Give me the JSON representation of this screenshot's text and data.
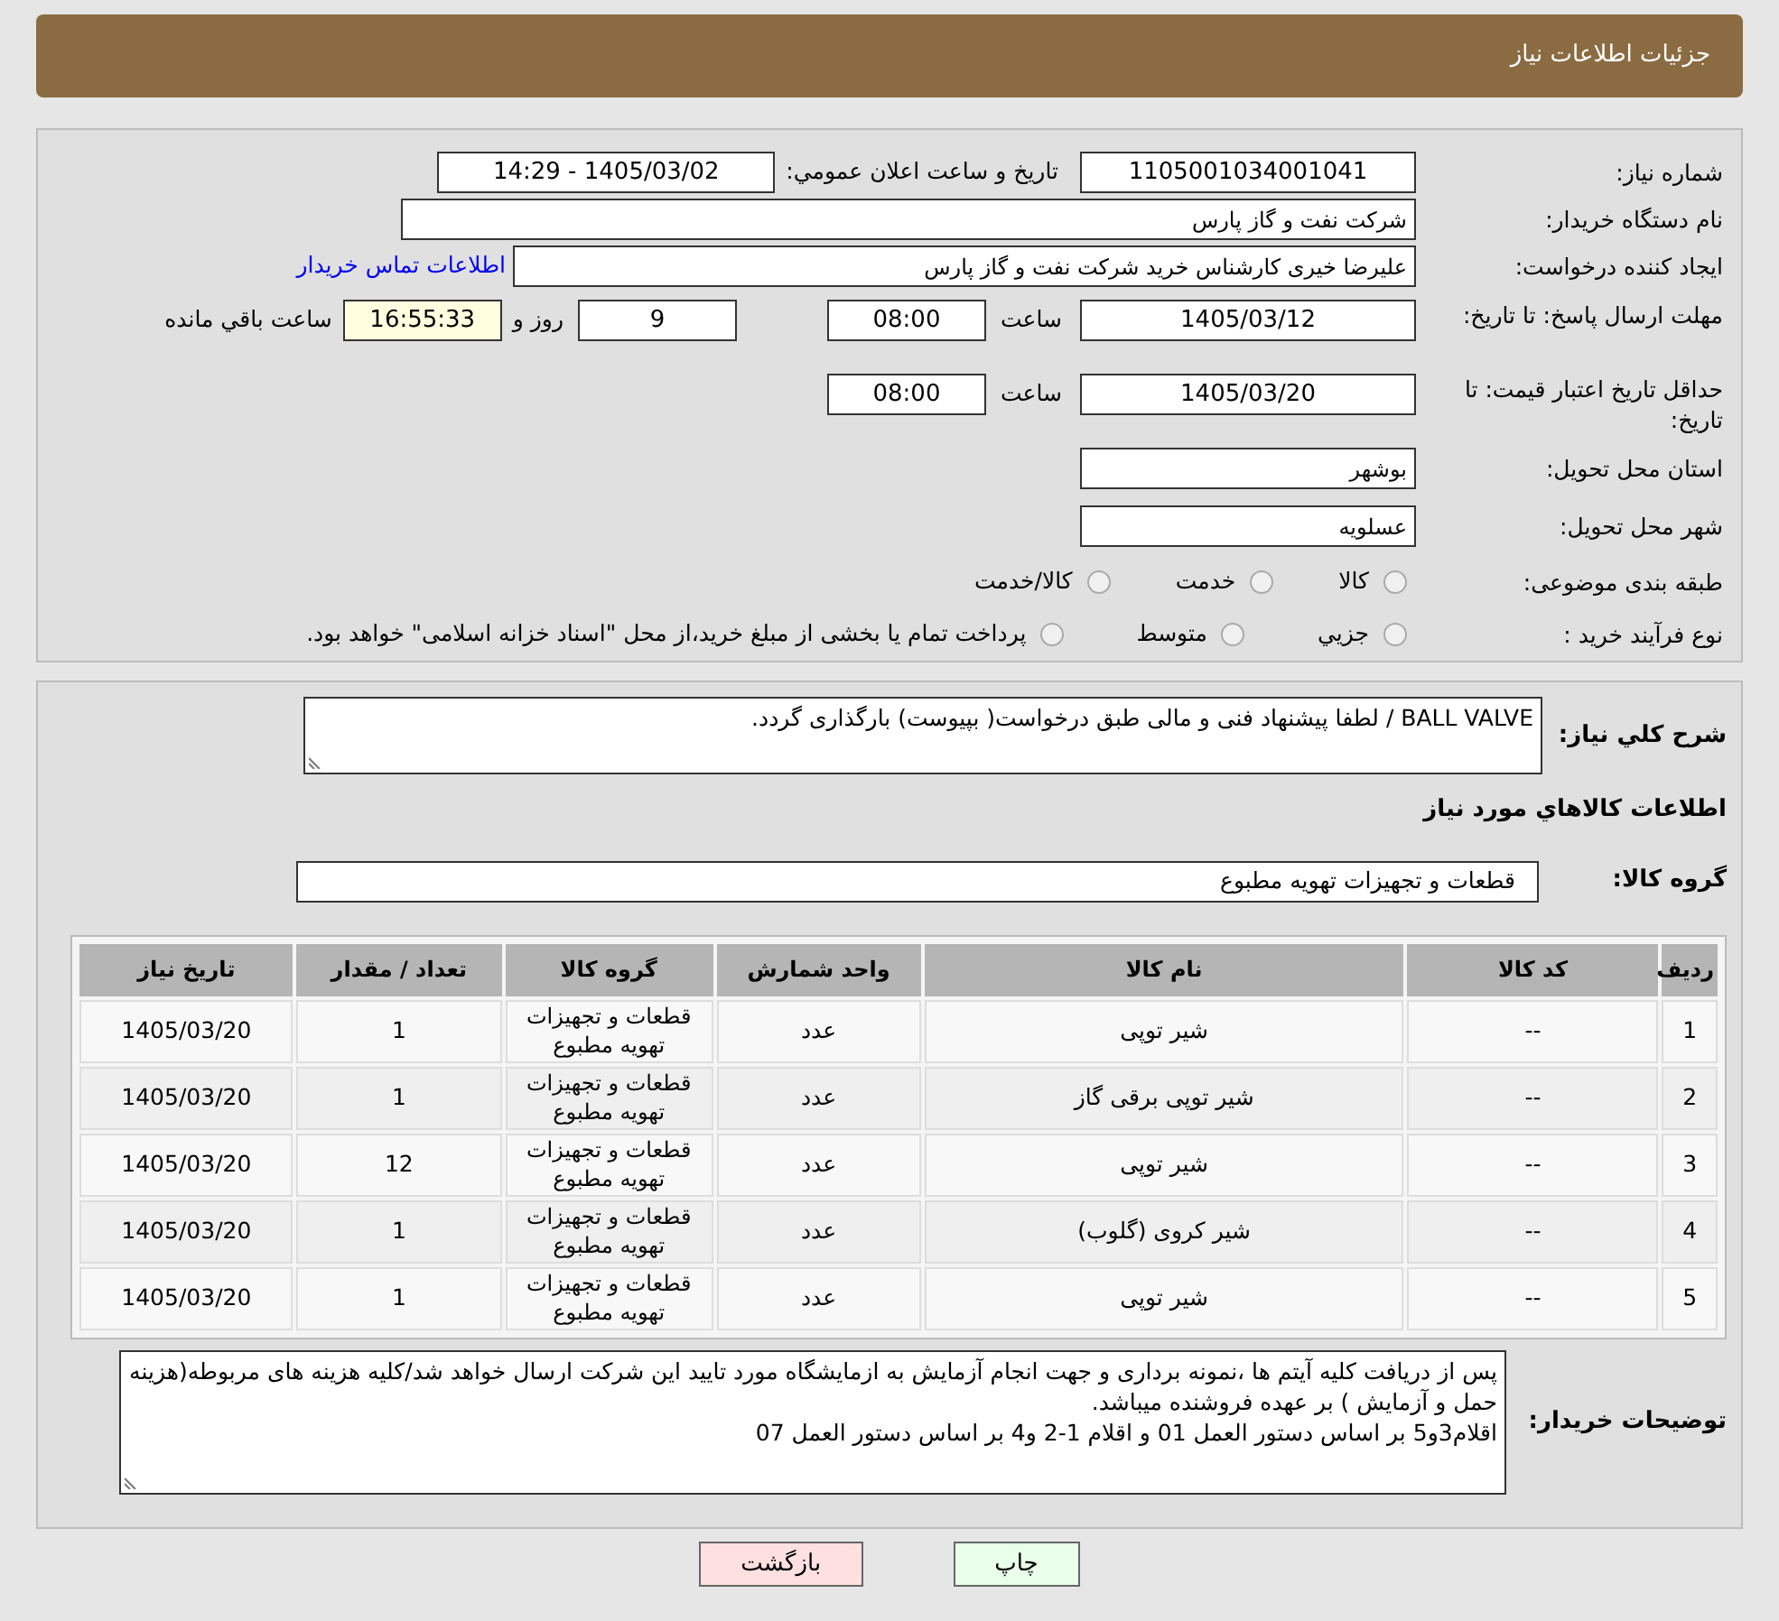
{
  "header": {
    "title": "جزئیات اطلاعات نیاز"
  },
  "details": {
    "need_number": {
      "label": "شماره نیاز:",
      "value": "1105001034001041"
    },
    "announce": {
      "label": "تاریخ و ساعت اعلان عمومي:",
      "value": "1405/03/02 - 14:29"
    },
    "buyer": {
      "label": "نام دستگاه خریدار:",
      "value": "شرکت نفت و گاز پارس"
    },
    "creator": {
      "label": "ایجاد کننده درخواست:",
      "value": "علیرضا  خیری کارشناس خرید  شرکت نفت و گاز پارس",
      "link": "اطلاعات تماس خریدار"
    },
    "deadline": {
      "label": "مهلت ارسال پاسخ: تا تاریخ:",
      "date": "1405/03/12",
      "time_label": "ساعت",
      "time": "08:00",
      "days": "9",
      "days_label": "روز و",
      "remaining": "16:55:33",
      "remaining_label": "ساعت باقي مانده"
    },
    "validity": {
      "label": "حداقل تاریخ اعتبار قیمت: تا تاریخ:",
      "date": "1405/03/20",
      "time_label": "ساعت",
      "time": "08:00"
    },
    "province": {
      "label": "استان محل تحویل:",
      "value": "بوشهر"
    },
    "city": {
      "label": "شهر محل تحویل:",
      "value": "عسلویه"
    },
    "category": {
      "label": "طبقه بندی موضوعی:",
      "options": [
        {
          "label": "کالا",
          "selected": false
        },
        {
          "label": "خدمت",
          "selected": false
        },
        {
          "label": "کالا/خدمت",
          "selected": false
        }
      ]
    },
    "process": {
      "label": "نوع فرآیند خرید :",
      "options": [
        {
          "label": "جزيي",
          "selected": false
        },
        {
          "label": "متوسط",
          "selected": false
        },
        {
          "selected": false
        }
      ],
      "note": "پرداخت تمام یا بخشی از مبلغ خرید،از محل \"اسناد خزانه اسلامی\" خواهد بود."
    }
  },
  "needs": {
    "description": {
      "label": "شرح کلي نياز:",
      "value": "BALL VALVE  / لطفا پیشنهاد فنی و مالی طبق درخواست( بپیوست) بارگذاری گردد."
    },
    "items_heading": "اطلاعات کالاهاي مورد نياز",
    "group": {
      "label": "گروه کالا:",
      "value": "قطعات و تجهیزات تهویه مطبوع"
    },
    "table": {
      "columns": [
        "ردیف",
        "کد کالا",
        "نام کالا",
        "واحد شمارش",
        "گروه کالا",
        "تعداد / مقدار",
        "تاریخ نیاز"
      ],
      "rows": [
        [
          "1",
          "--",
          "شیر توپی",
          "عدد",
          "قطعات و تجهیزات تهویه مطبوع",
          "1",
          "1405/03/20"
        ],
        [
          "2",
          "--",
          "شیر توپی برقی گاز",
          "عدد",
          "قطعات و تجهیزات تهویه مطبوع",
          "1",
          "1405/03/20"
        ],
        [
          "3",
          "--",
          "شیر توپی",
          "عدد",
          "قطعات و تجهیزات تهویه مطبوع",
          "12",
          "1405/03/20"
        ],
        [
          "4",
          "--",
          "شیر کروی (گلوب)",
          "عدد",
          "قطعات و تجهیزات تهویه مطبوع",
          "1",
          "1405/03/20"
        ],
        [
          "5",
          "--",
          "شیر توپی",
          "عدد",
          "قطعات و تجهیزات تهویه مطبوع",
          "1",
          "1405/03/20"
        ]
      ]
    },
    "comments": {
      "label": "توضیحات خریدار:",
      "lines": [
        "پس از دریافت کلیه آیتم ها ،نمونه برداری و جهت انجام آزمایش به ازمایشگاه مورد تایید این شرکت ارسال خواهد شد/کلیه هزینه های مربوطه(هزینه حمل و آزمایش ) بر عهده فروشنده میباشد.",
        "اقلام3و5 بر اساس دستور العمل 01 و اقلام 1-2 و4 بر اساس دستور العمل 07"
      ]
    }
  },
  "buttons": [
    {
      "kind": "print",
      "label": "چاپ"
    },
    {
      "kind": "back",
      "label": "بازگشت"
    }
  ]
}
